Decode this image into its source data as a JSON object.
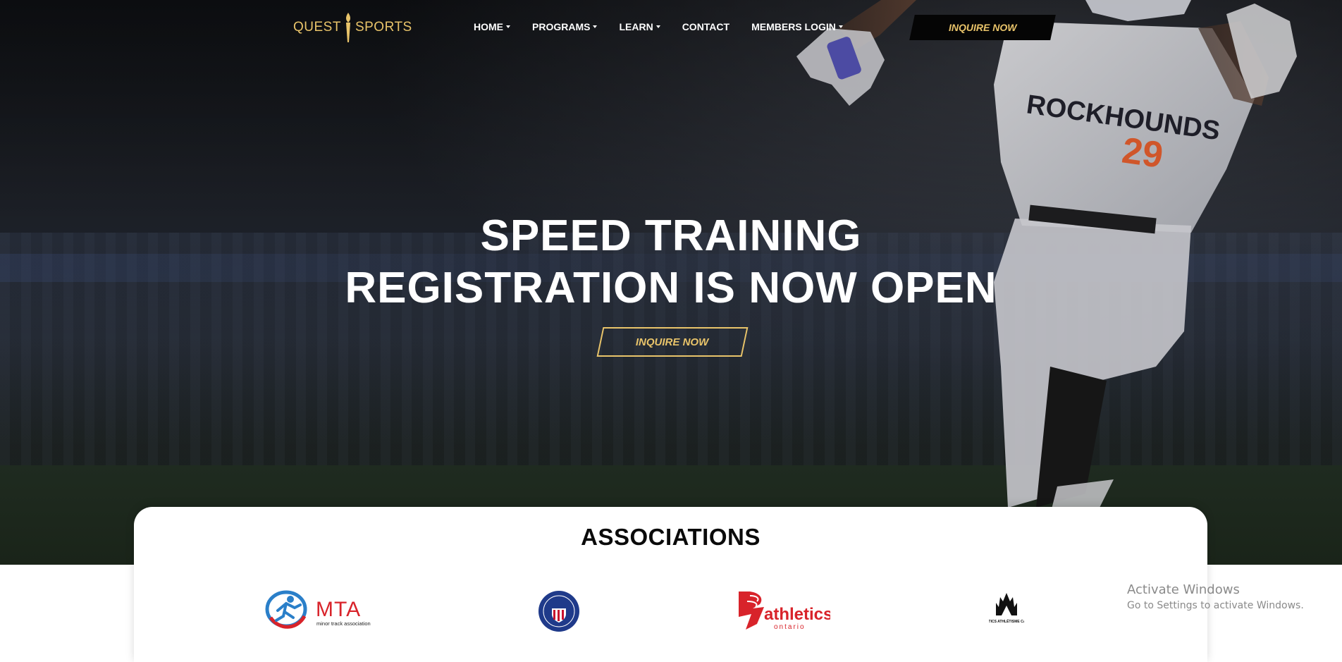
{
  "brand": {
    "logo_text_left": "QUEST",
    "logo_text_right": "SPORTS",
    "gold": "#e9c46a"
  },
  "nav": {
    "items": [
      {
        "label": "HOME",
        "has_dropdown": true
      },
      {
        "label": "PROGRAMS",
        "has_dropdown": true
      },
      {
        "label": "LEARN",
        "has_dropdown": true
      },
      {
        "label": "CONTACT",
        "has_dropdown": false
      },
      {
        "label": "MEMBERS LOGIN",
        "has_dropdown": true
      }
    ],
    "cta_label": "INQUIRE NOW"
  },
  "hero": {
    "headline_line1": "SPEED TRAINING",
    "headline_line2": "REGISTRATION IS NOW OPEN",
    "cta_label": "INQUIRE NOW",
    "jersey_team": "ROCKHOUNDS",
    "jersey_number": "29"
  },
  "associations": {
    "title": "ASSOCIATIONS",
    "logos": [
      {
        "name": "MTA",
        "subtitle": "minor track association",
        "icon": "mta-logo"
      },
      {
        "name": "",
        "icon": "track-and-field-seal-logo"
      },
      {
        "name": "athletics",
        "subtitle": "ontario",
        "icon": "athletics-ontario-logo"
      },
      {
        "name": "ATHLETICS ATHLÉTISME CANADA",
        "icon": "athletics-canada-logo"
      }
    ]
  },
  "watermark": {
    "title": "Activate Windows",
    "subtitle": "Go to Settings to activate Windows."
  }
}
